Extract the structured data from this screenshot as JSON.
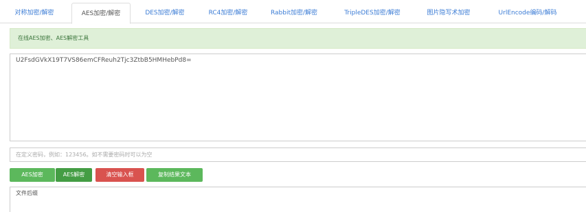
{
  "tabs": [
    {
      "label": "对称加密/解密"
    },
    {
      "label": "AES加密/解密"
    },
    {
      "label": "DES加密/解密"
    },
    {
      "label": "RC4加密/解密"
    },
    {
      "label": "Rabbit加密/解密"
    },
    {
      "label": "TripleDES加密/解密"
    },
    {
      "label": "图片隐写术加密"
    },
    {
      "label": "UrlEncode编码/解码"
    }
  ],
  "active_tab": "AES加密/解密",
  "alert": {
    "text": "在线AES加密、AES解密工具"
  },
  "main_input": {
    "value": "U2FsdGVkX19T7VS86emCFReuh2Tjc3ZtbB5HMHebPd8="
  },
  "password": {
    "placeholder": "在定义密码，例如：123456。如不需要密码时可以为空"
  },
  "buttons": {
    "encrypt": "AES加密",
    "decrypt": "AES解密",
    "clear": "清空输入框",
    "copy": "复制结果文本"
  },
  "output": {
    "placeholder": "文件后缀"
  },
  "colors": {
    "link": "#3a7bd5",
    "success": "#5cb85c",
    "success_dark": "#449d44",
    "danger": "#d9534f",
    "alert_bg": "#dff0d8",
    "alert_text": "#3c763d"
  }
}
